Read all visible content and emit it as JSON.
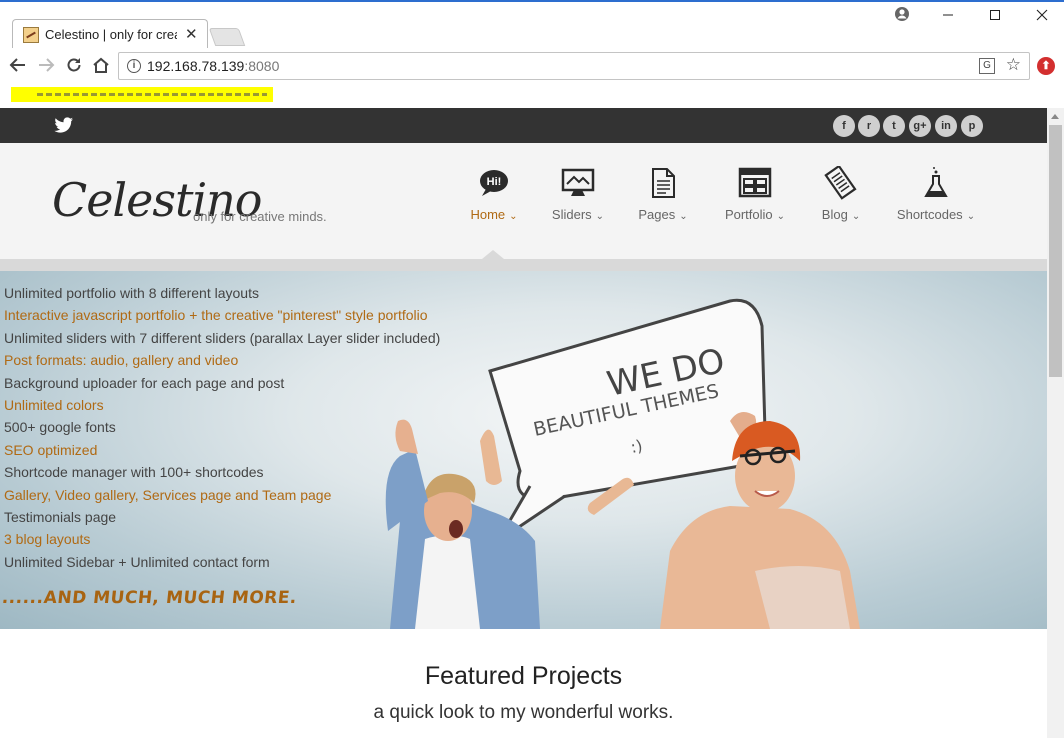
{
  "browser": {
    "tab_title": "Celestino | only for crea",
    "url_host": "192.168.78.139",
    "url_port": ":8080"
  },
  "topbar": {
    "social_icons": [
      "facebook-icon",
      "rss-icon",
      "twitter-icon",
      "google-plus-icon",
      "linkedin-icon",
      "pinterest-icon"
    ],
    "social_glyphs": [
      "f",
      "r",
      "t",
      "g+",
      "in",
      "p"
    ]
  },
  "header": {
    "logo": "Celestino",
    "tagline": "only for creative minds.",
    "nav": [
      {
        "label": "Home",
        "icon": "hi-speech-icon",
        "active": true
      },
      {
        "label": "Sliders",
        "icon": "monitor-icon"
      },
      {
        "label": "Pages",
        "icon": "page-icon"
      },
      {
        "label": "Portfolio",
        "icon": "layout-icon"
      },
      {
        "label": "Blog",
        "icon": "notepad-icon"
      },
      {
        "label": "Shortcodes",
        "icon": "flask-icon"
      }
    ]
  },
  "hero": {
    "features": [
      "Unlimited portfolio with 8 different layouts",
      "Interactive javascript portfolio + the creative \"pinterest\" style portfolio",
      "Unlimited sliders with 7 different sliders (parallax Layer slider included)",
      "Post formats: audio, gallery and video",
      "Background uploader for each page and post",
      "Unlimited colors",
      "500+ google fonts",
      "SEO optimized",
      "Shortcode manager with 100+ shortcodes",
      "Gallery, Video gallery, Services page and Team page",
      "Testimonials page",
      "3 blog layouts",
      "Unlimited Sidebar + Unlimited contact form"
    ],
    "more": "......AND MUCH, MUCH MORE.",
    "bubble_line1": "WE DO",
    "bubble_line2": "BEAUTIFUL THEMES",
    "bubble_line3": ":)"
  },
  "featured": {
    "heading": "Featured Projects",
    "subheading": "a quick look to my wonderful works."
  },
  "colors": {
    "accent": "#b06a14",
    "topbar": "#333333",
    "header_bg": "#f4f4f4"
  }
}
